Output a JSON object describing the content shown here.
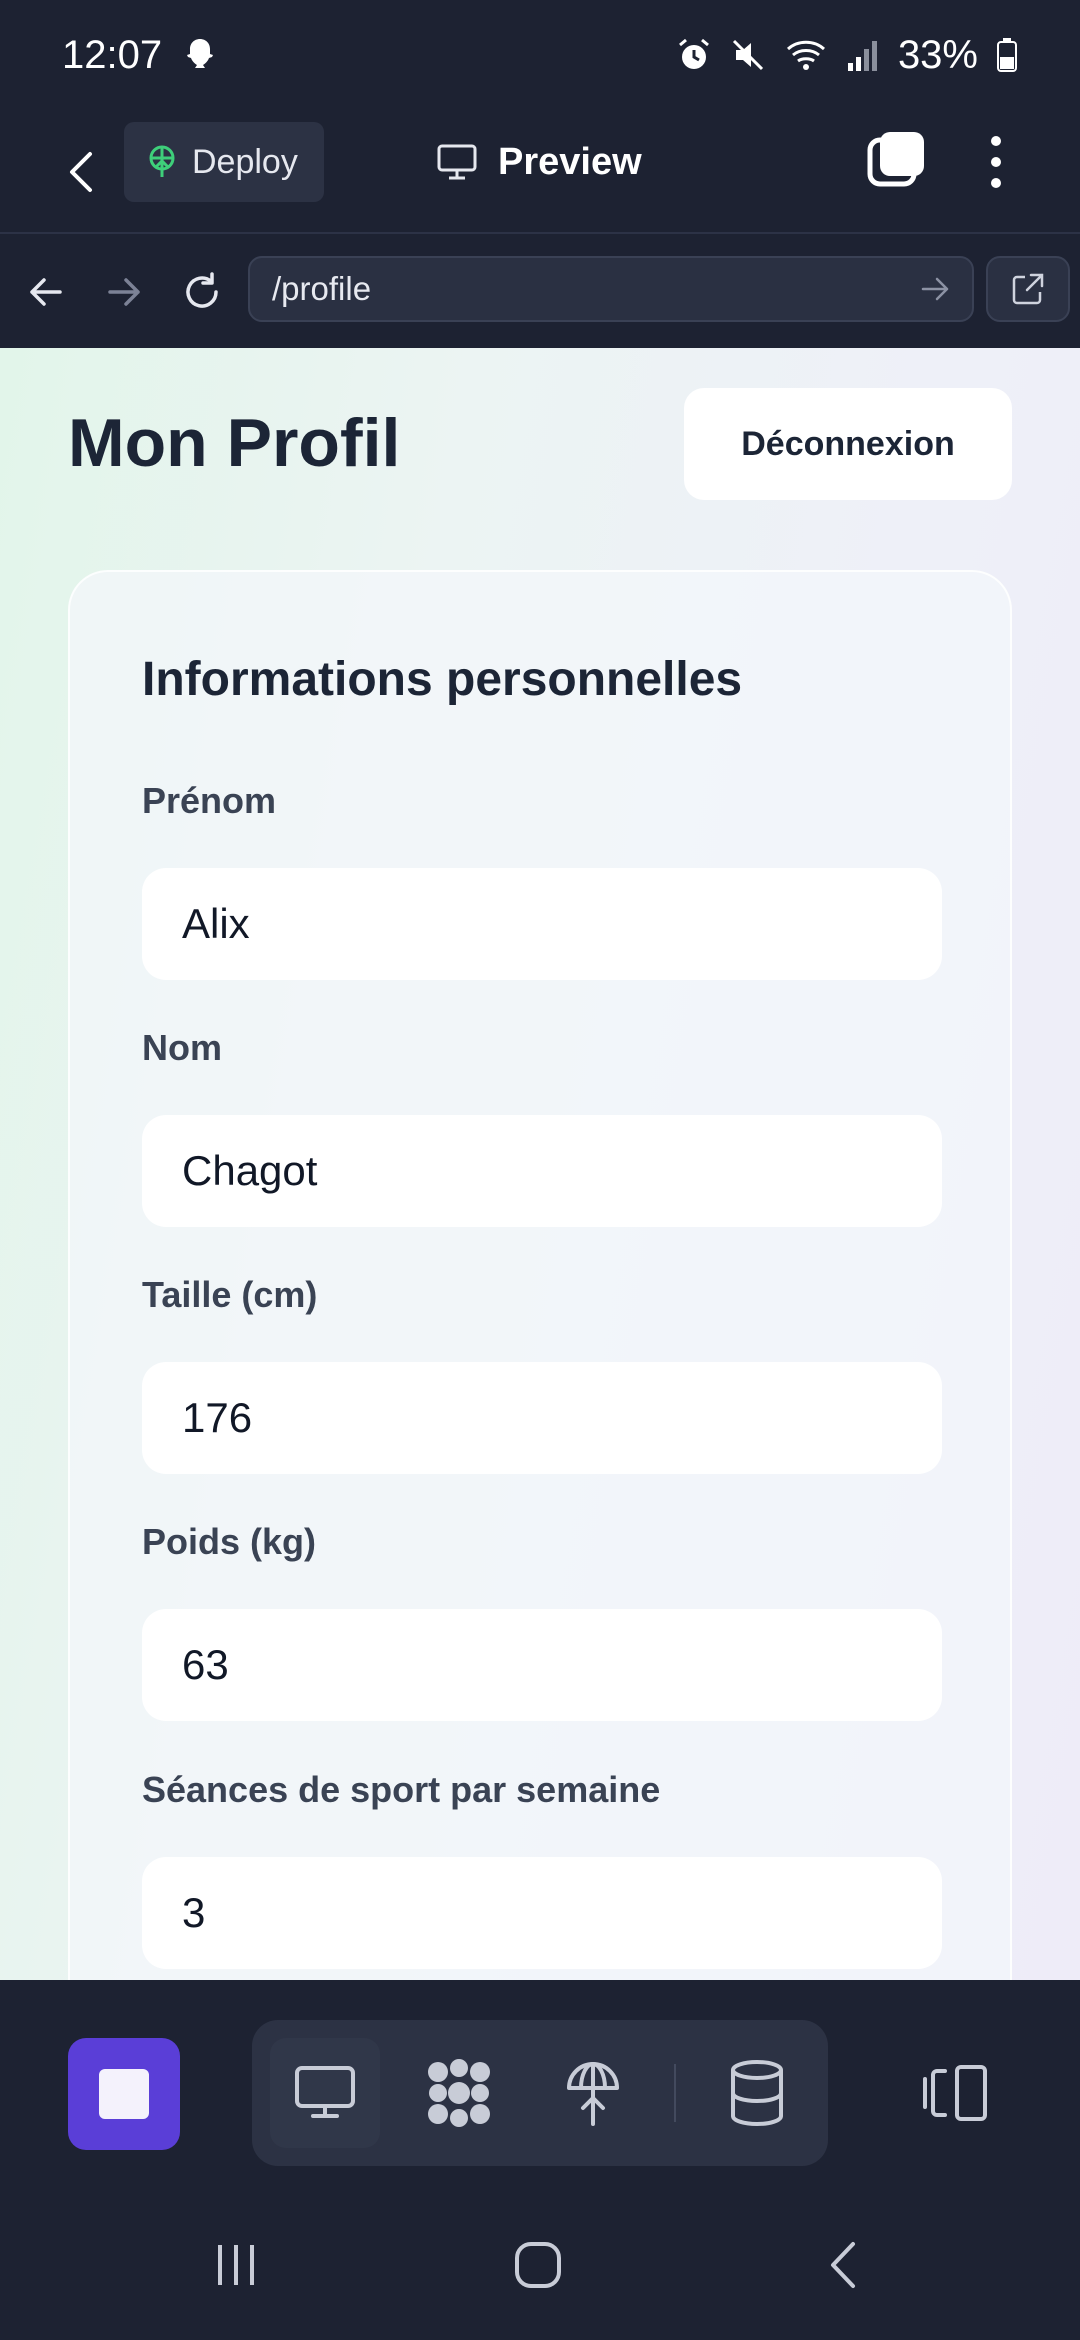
{
  "status_bar": {
    "time": "12:07",
    "battery": "33%",
    "icons": [
      "snapchat-icon",
      "alarm-icon",
      "mute-icon",
      "wifi-icon",
      "signal-icon",
      "battery-icon"
    ]
  },
  "app_bar": {
    "deploy_label": "Deploy",
    "title": "Preview"
  },
  "url_bar": {
    "url": "/profile"
  },
  "page": {
    "title": "Mon Profil",
    "logout_label": "Déconnexion",
    "section_title": "Informations personnelles",
    "fields": [
      {
        "label": "Prénom",
        "value": "Alix"
      },
      {
        "label": "Nom",
        "value": "Chagot"
      },
      {
        "label": "Taille (cm)",
        "value": "176"
      },
      {
        "label": "Poids (kg)",
        "value": "63"
      },
      {
        "label": "Séances de sport par semaine",
        "value": "3"
      }
    ]
  },
  "bottom_toolbar": {
    "tools": [
      "preview-icon",
      "agents-icon",
      "deploy-icon",
      "database-icon"
    ],
    "active_tool": "preview-icon"
  },
  "colors": {
    "background": "#1d2232",
    "accent": "#5a3ed7",
    "deploy_green": "#3ecf7a"
  }
}
